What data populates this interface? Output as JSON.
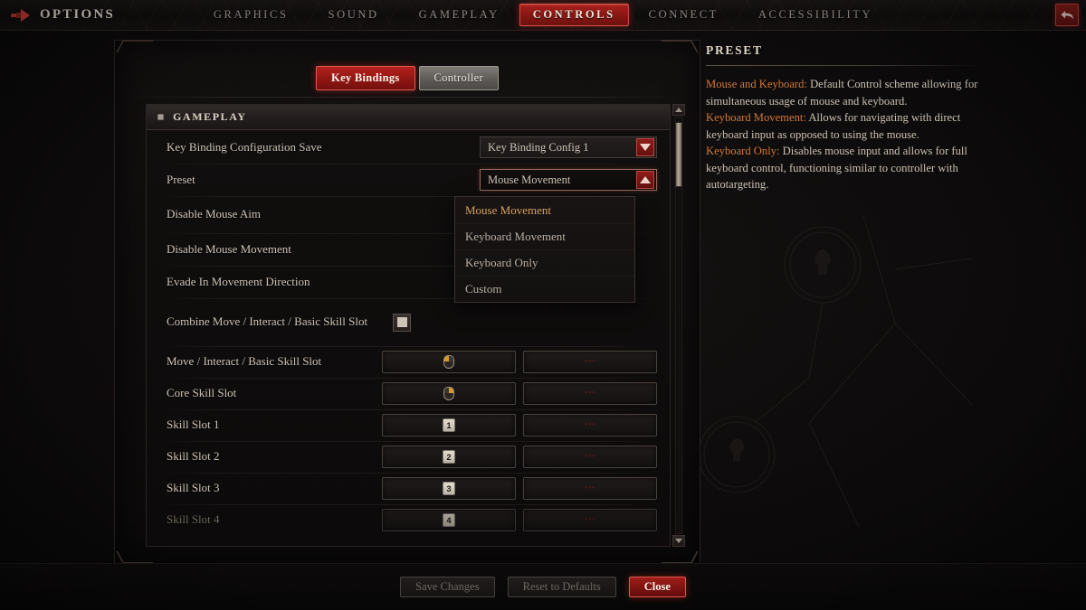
{
  "topbar": {
    "logo_icon": "arrow-right-icon",
    "title": "OPTIONS",
    "back_icon": "back-arrow-icon",
    "nav": [
      {
        "label": "GRAPHICS",
        "active": false
      },
      {
        "label": "SOUND",
        "active": false
      },
      {
        "label": "GAMEPLAY",
        "active": false
      },
      {
        "label": "CONTROLS",
        "active": true
      },
      {
        "label": "CONNECT",
        "active": false
      },
      {
        "label": "ACCESSIBILITY",
        "active": false
      }
    ]
  },
  "tabs": {
    "key_bindings": "Key Bindings",
    "controller": "Controller"
  },
  "section": {
    "icon": "diamond-icon",
    "title": "GAMEPLAY"
  },
  "rows": {
    "config_save": {
      "label": "Key Binding Configuration Save",
      "value": "Key Binding Config 1",
      "caret_icon": "chevron-down-icon"
    },
    "preset": {
      "label": "Preset",
      "value": "Mouse Movement",
      "caret_icon": "chevron-up-icon",
      "open": true,
      "options": [
        {
          "label": "Mouse Movement",
          "selected": true
        },
        {
          "label": "Keyboard Movement",
          "selected": false
        },
        {
          "label": "Keyboard Only",
          "selected": false
        },
        {
          "label": "Custom",
          "selected": false
        }
      ]
    },
    "disable_mouse_aim": {
      "label": "Disable Mouse Aim"
    },
    "disable_mouse_movement": {
      "label": "Disable Mouse Movement"
    },
    "evade_in_movement_direction": {
      "label": "Evade In Movement Direction"
    },
    "combine_move": {
      "label": "Combine Move / Interact / Basic Skill Slot",
      "checked": true
    }
  },
  "bindings": [
    {
      "label": "Move / Interact / Basic Skill Slot",
      "primary": {
        "type": "mouse",
        "button": "left"
      },
      "secondary": {
        "type": "empty",
        "mark": "•••"
      },
      "dim": false
    },
    {
      "label": "Core Skill Slot",
      "primary": {
        "type": "mouse",
        "button": "right"
      },
      "secondary": {
        "type": "empty",
        "mark": "•••"
      },
      "dim": false
    },
    {
      "label": "Skill Slot 1",
      "primary": {
        "type": "key",
        "key": "1"
      },
      "secondary": {
        "type": "empty",
        "mark": "•••"
      },
      "dim": false
    },
    {
      "label": "Skill Slot 2",
      "primary": {
        "type": "key",
        "key": "2"
      },
      "secondary": {
        "type": "empty",
        "mark": "•••"
      },
      "dim": false
    },
    {
      "label": "Skill Slot 3",
      "primary": {
        "type": "key",
        "key": "3"
      },
      "secondary": {
        "type": "empty",
        "mark": "•••"
      },
      "dim": false
    },
    {
      "label": "Skill Slot 4",
      "primary": {
        "type": "key",
        "key": "4"
      },
      "secondary": {
        "type": "empty",
        "mark": "•••"
      },
      "dim": true
    }
  ],
  "scrollbar": {
    "up_icon": "scroll-up-icon",
    "down_icon": "scroll-down-icon"
  },
  "info": {
    "title": "PRESET",
    "entries": [
      {
        "term": "Mouse and Keyboard:",
        "desc": " Default Control scheme allowing for simultaneous usage of mouse and keyboard."
      },
      {
        "term": "Keyboard Movement:",
        "desc": " Allows for navigating with direct keyboard input as opposed to using the mouse."
      },
      {
        "term": "Keyboard Only:",
        "desc": " Disables mouse input and allows for full keyboard control, functioning similar to controller with autotargeting."
      }
    ]
  },
  "bottom": {
    "save": "Save Changes",
    "reset": "Reset to Defaults",
    "close": "Close"
  },
  "colors": {
    "accent_red": "#a01c18",
    "accent_orange": "#d07a3a",
    "selected_gold": "#d9a15e",
    "text": "#cfc5b8"
  }
}
